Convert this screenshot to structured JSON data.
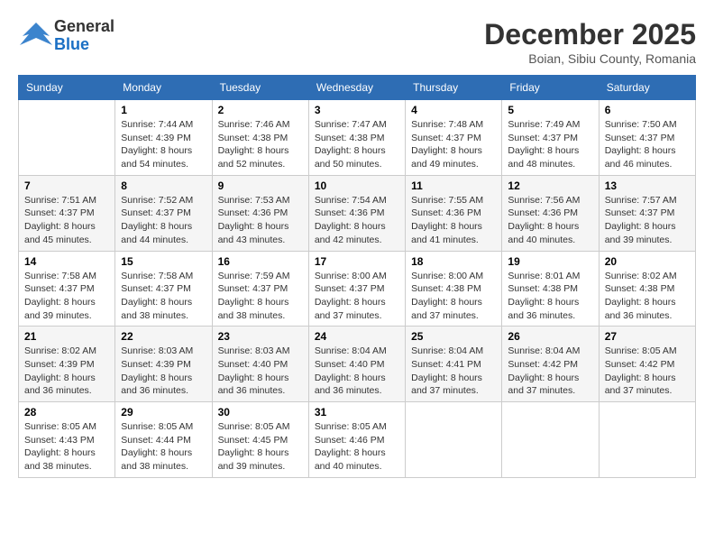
{
  "header": {
    "logo_general": "General",
    "logo_blue": "Blue",
    "month": "December 2025",
    "location": "Boian, Sibiu County, Romania"
  },
  "days_of_week": [
    "Sunday",
    "Monday",
    "Tuesday",
    "Wednesday",
    "Thursday",
    "Friday",
    "Saturday"
  ],
  "weeks": [
    [
      {
        "day": "",
        "info": ""
      },
      {
        "day": "1",
        "info": "Sunrise: 7:44 AM\nSunset: 4:39 PM\nDaylight: 8 hours\nand 54 minutes."
      },
      {
        "day": "2",
        "info": "Sunrise: 7:46 AM\nSunset: 4:38 PM\nDaylight: 8 hours\nand 52 minutes."
      },
      {
        "day": "3",
        "info": "Sunrise: 7:47 AM\nSunset: 4:38 PM\nDaylight: 8 hours\nand 50 minutes."
      },
      {
        "day": "4",
        "info": "Sunrise: 7:48 AM\nSunset: 4:37 PM\nDaylight: 8 hours\nand 49 minutes."
      },
      {
        "day": "5",
        "info": "Sunrise: 7:49 AM\nSunset: 4:37 PM\nDaylight: 8 hours\nand 48 minutes."
      },
      {
        "day": "6",
        "info": "Sunrise: 7:50 AM\nSunset: 4:37 PM\nDaylight: 8 hours\nand 46 minutes."
      }
    ],
    [
      {
        "day": "7",
        "info": "Sunrise: 7:51 AM\nSunset: 4:37 PM\nDaylight: 8 hours\nand 45 minutes."
      },
      {
        "day": "8",
        "info": "Sunrise: 7:52 AM\nSunset: 4:37 PM\nDaylight: 8 hours\nand 44 minutes."
      },
      {
        "day": "9",
        "info": "Sunrise: 7:53 AM\nSunset: 4:36 PM\nDaylight: 8 hours\nand 43 minutes."
      },
      {
        "day": "10",
        "info": "Sunrise: 7:54 AM\nSunset: 4:36 PM\nDaylight: 8 hours\nand 42 minutes."
      },
      {
        "day": "11",
        "info": "Sunrise: 7:55 AM\nSunset: 4:36 PM\nDaylight: 8 hours\nand 41 minutes."
      },
      {
        "day": "12",
        "info": "Sunrise: 7:56 AM\nSunset: 4:36 PM\nDaylight: 8 hours\nand 40 minutes."
      },
      {
        "day": "13",
        "info": "Sunrise: 7:57 AM\nSunset: 4:37 PM\nDaylight: 8 hours\nand 39 minutes."
      }
    ],
    [
      {
        "day": "14",
        "info": "Sunrise: 7:58 AM\nSunset: 4:37 PM\nDaylight: 8 hours\nand 39 minutes."
      },
      {
        "day": "15",
        "info": "Sunrise: 7:58 AM\nSunset: 4:37 PM\nDaylight: 8 hours\nand 38 minutes."
      },
      {
        "day": "16",
        "info": "Sunrise: 7:59 AM\nSunset: 4:37 PM\nDaylight: 8 hours\nand 38 minutes."
      },
      {
        "day": "17",
        "info": "Sunrise: 8:00 AM\nSunset: 4:37 PM\nDaylight: 8 hours\nand 37 minutes."
      },
      {
        "day": "18",
        "info": "Sunrise: 8:00 AM\nSunset: 4:38 PM\nDaylight: 8 hours\nand 37 minutes."
      },
      {
        "day": "19",
        "info": "Sunrise: 8:01 AM\nSunset: 4:38 PM\nDaylight: 8 hours\nand 36 minutes."
      },
      {
        "day": "20",
        "info": "Sunrise: 8:02 AM\nSunset: 4:38 PM\nDaylight: 8 hours\nand 36 minutes."
      }
    ],
    [
      {
        "day": "21",
        "info": "Sunrise: 8:02 AM\nSunset: 4:39 PM\nDaylight: 8 hours\nand 36 minutes."
      },
      {
        "day": "22",
        "info": "Sunrise: 8:03 AM\nSunset: 4:39 PM\nDaylight: 8 hours\nand 36 minutes."
      },
      {
        "day": "23",
        "info": "Sunrise: 8:03 AM\nSunset: 4:40 PM\nDaylight: 8 hours\nand 36 minutes."
      },
      {
        "day": "24",
        "info": "Sunrise: 8:04 AM\nSunset: 4:40 PM\nDaylight: 8 hours\nand 36 minutes."
      },
      {
        "day": "25",
        "info": "Sunrise: 8:04 AM\nSunset: 4:41 PM\nDaylight: 8 hours\nand 37 minutes."
      },
      {
        "day": "26",
        "info": "Sunrise: 8:04 AM\nSunset: 4:42 PM\nDaylight: 8 hours\nand 37 minutes."
      },
      {
        "day": "27",
        "info": "Sunrise: 8:05 AM\nSunset: 4:42 PM\nDaylight: 8 hours\nand 37 minutes."
      }
    ],
    [
      {
        "day": "28",
        "info": "Sunrise: 8:05 AM\nSunset: 4:43 PM\nDaylight: 8 hours\nand 38 minutes."
      },
      {
        "day": "29",
        "info": "Sunrise: 8:05 AM\nSunset: 4:44 PM\nDaylight: 8 hours\nand 38 minutes."
      },
      {
        "day": "30",
        "info": "Sunrise: 8:05 AM\nSunset: 4:45 PM\nDaylight: 8 hours\nand 39 minutes."
      },
      {
        "day": "31",
        "info": "Sunrise: 8:05 AM\nSunset: 4:46 PM\nDaylight: 8 hours\nand 40 minutes."
      },
      {
        "day": "",
        "info": ""
      },
      {
        "day": "",
        "info": ""
      },
      {
        "day": "",
        "info": ""
      }
    ]
  ]
}
